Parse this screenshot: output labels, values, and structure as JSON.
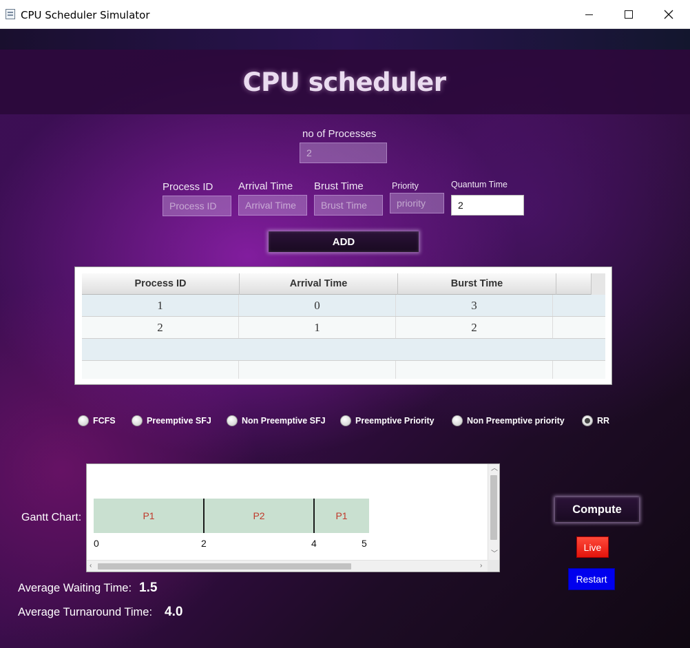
{
  "window": {
    "title": "CPU Scheduler Simulator"
  },
  "header": {
    "title": "CPU scheduler"
  },
  "processes_count": {
    "label": "no of Processes",
    "value": "2"
  },
  "inputs": {
    "process_id": {
      "label": "Process ID",
      "placeholder": "Process ID"
    },
    "arrival_time": {
      "label": "Arrival Time",
      "placeholder": "Arrival Time"
    },
    "burst_time": {
      "label": "Brust Time",
      "placeholder": "Brust Time"
    },
    "priority": {
      "label": "Priority",
      "placeholder": "priority"
    },
    "quantum_time": {
      "label": "Quantum Time",
      "value": "2"
    }
  },
  "add_button": "ADD",
  "table": {
    "columns": [
      "Process ID",
      "Arrival Time",
      "Burst Time"
    ],
    "rows": [
      [
        "1",
        "0",
        "3"
      ],
      [
        "2",
        "1",
        "2"
      ]
    ]
  },
  "algorithms": {
    "options": [
      "FCFS",
      "Preemptive SFJ",
      "Non Preemptive SFJ",
      "Preemptive Priority",
      "Non Preemptive priority",
      "RR"
    ],
    "selected": "RR"
  },
  "gantt": {
    "label": "Gantt Chart:",
    "segments": [
      {
        "process": "P1",
        "start": 0,
        "end": 2
      },
      {
        "process": "P2",
        "start": 2,
        "end": 4
      },
      {
        "process": "P1",
        "start": 4,
        "end": 5
      }
    ],
    "ticks": [
      "0",
      "2",
      "4",
      "5"
    ],
    "bar_color": "#c9e0d0",
    "text_color": "#c0392b"
  },
  "buttons": {
    "compute": "Compute",
    "live": "Live",
    "restart": "Restart"
  },
  "stats": {
    "avg_waiting_label": "Average Waiting Time:",
    "avg_waiting_value": "1.5",
    "avg_turnaround_label": "Average Turnaround Time:",
    "avg_turnaround_value": "4.0"
  }
}
